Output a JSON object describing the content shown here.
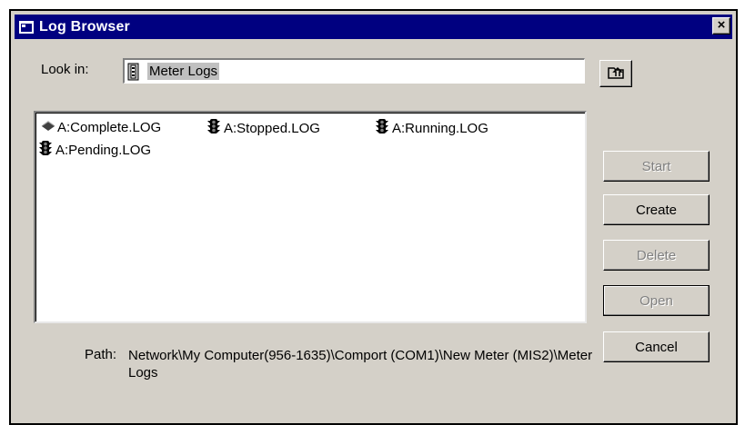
{
  "window": {
    "title": "Log Browser",
    "close_glyph": "×"
  },
  "look_in": {
    "label": "Look in:",
    "value": "Meter Logs",
    "icon": "meter-icon"
  },
  "up_button": {
    "icon": "up-one-level-icon"
  },
  "logs": [
    {
      "name": "A:Complete.LOG",
      "icon": "complete-log-icon"
    },
    {
      "name": "A:Stopped.LOG",
      "icon": "stoplight-icon"
    },
    {
      "name": "A:Running.LOG",
      "icon": "stoplight-icon"
    },
    {
      "name": "A:Pending.LOG",
      "icon": "stoplight-icon"
    }
  ],
  "buttons": {
    "start": {
      "label": "Start",
      "enabled": false
    },
    "create": {
      "label": "Create",
      "enabled": true
    },
    "delete": {
      "label": "Delete",
      "enabled": false
    },
    "open": {
      "label": "Open",
      "enabled": false
    },
    "cancel": {
      "label": "Cancel",
      "enabled": true
    }
  },
  "path": {
    "label": "Path:",
    "value": "Network\\My Computer(956-1635)\\Comport (COM1)\\New Meter (MIS2)\\Meter Logs"
  },
  "colors": {
    "titlebar": "#000080",
    "face": "#d4d0c8",
    "selection": "#c0c0c0"
  }
}
